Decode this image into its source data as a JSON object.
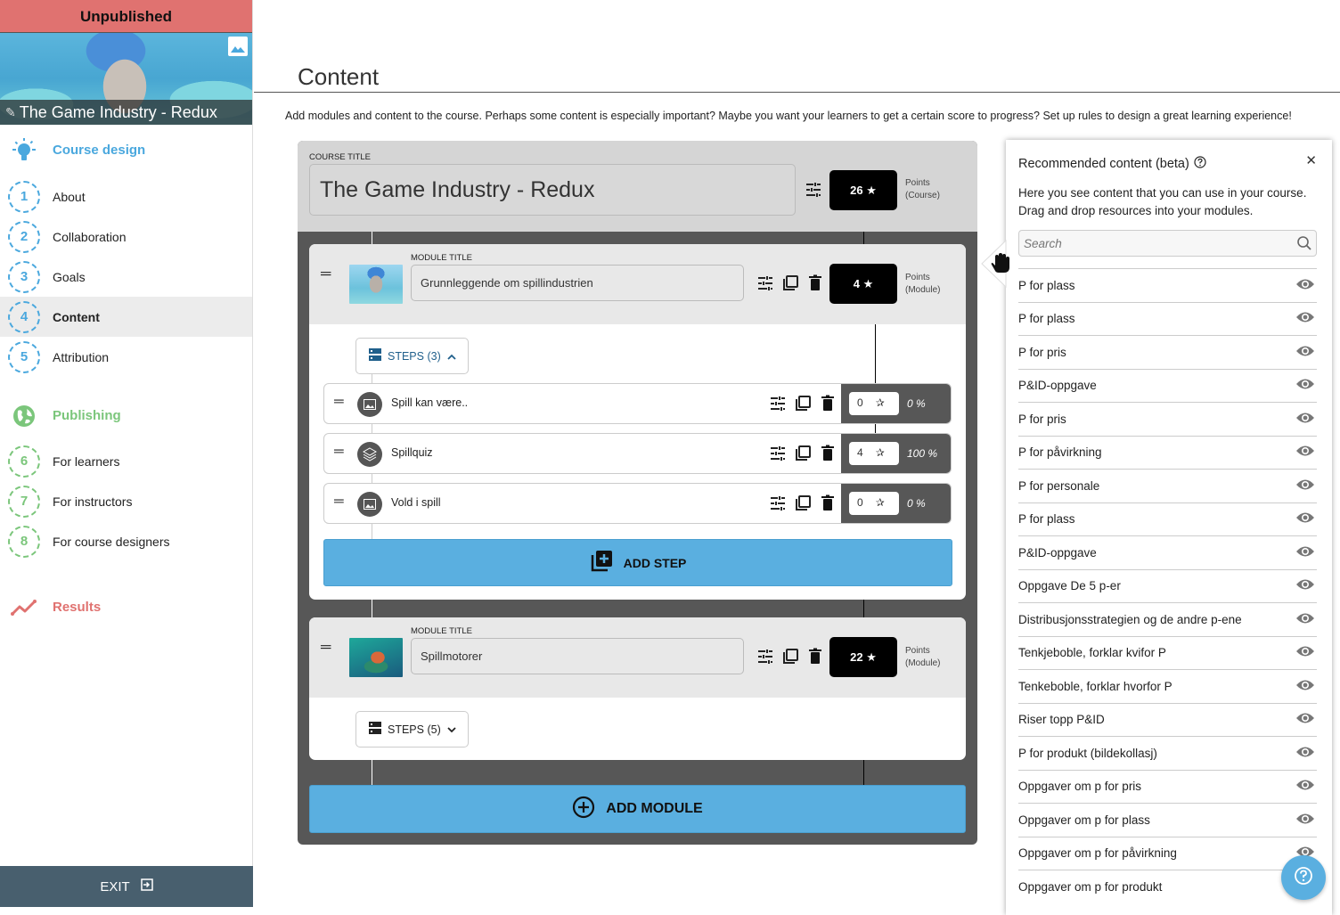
{
  "sidebar": {
    "status": "Unpublished",
    "course_title": "The Game Industry - Redux",
    "sections": {
      "design": {
        "label": "Course design",
        "color": "#4aa8de"
      },
      "publishing": {
        "label": "Publishing",
        "color": "#7bc67b"
      },
      "results": {
        "label": "Results",
        "color": "#e07270"
      }
    },
    "design_items": [
      {
        "num": "1",
        "label": "About"
      },
      {
        "num": "2",
        "label": "Collaboration"
      },
      {
        "num": "3",
        "label": "Goals"
      },
      {
        "num": "4",
        "label": "Content",
        "active": true
      },
      {
        "num": "5",
        "label": "Attribution"
      }
    ],
    "publishing_items": [
      {
        "num": "6",
        "label": "For learners"
      },
      {
        "num": "7",
        "label": "For instructors"
      },
      {
        "num": "8",
        "label": "For course designers"
      }
    ],
    "exit_label": "EXIT"
  },
  "main": {
    "title": "Content",
    "intro": "Add modules and content to the course. Perhaps some content is especially important? Maybe you want your learners to get a certain score to progress? Set up rules to design a great learning experience!",
    "course": {
      "label": "COURSE TITLE",
      "title": "The Game Industry - Redux",
      "points": "26",
      "points_caption_1": "Points",
      "points_caption_2": "(Course)"
    },
    "modules": [
      {
        "label": "MODULE TITLE",
        "title": "Grunnleggende om spillindustrien",
        "points": "4",
        "points_caption_1": "Points",
        "points_caption_2": "(Module)",
        "steps_label": "STEPS (3)",
        "expanded": true,
        "steps": [
          {
            "name": "Spill kan være..",
            "type": "image",
            "score": "0",
            "percent": "0 %"
          },
          {
            "name": "Spillquiz",
            "type": "quiz",
            "score": "4",
            "percent": "100 %"
          },
          {
            "name": "Vold i spill",
            "type": "image",
            "score": "0",
            "percent": "0 %"
          }
        ],
        "add_step_label": "ADD STEP"
      },
      {
        "label": "MODULE TITLE",
        "title": "Spillmotorer",
        "points": "22",
        "points_caption_1": "Points",
        "points_caption_2": "(Module)",
        "steps_label": "STEPS (5)",
        "expanded": false
      }
    ],
    "add_module_label": "ADD MODULE",
    "accent_color": "#5aafe0"
  },
  "recommended": {
    "title": "Recommended content (beta)",
    "description": "Here you see content that you can use in your course. Drag and drop resources into your modules.",
    "search_placeholder": "Search",
    "search_value": "",
    "items": [
      "P for plass",
      "P for plass",
      "P for pris",
      "P&ID-oppgave",
      "P for pris",
      "P for påvirkning",
      "P for personale",
      "P for plass",
      "P&ID-oppgave",
      "Oppgave De 5 p-er",
      "Distribusjonsstrategien og de andre p-ene",
      "Tenkjeboble, forklar kvifor P",
      "Tenkeboble, forklar hvorfor P",
      "Riser topp P&ID",
      "P for produkt (bildekollasj)",
      "Oppgaver om p for pris",
      "Oppgaver om p for plass",
      "Oppgaver om p for påvirkning",
      "Oppgaver om p for produkt"
    ]
  }
}
